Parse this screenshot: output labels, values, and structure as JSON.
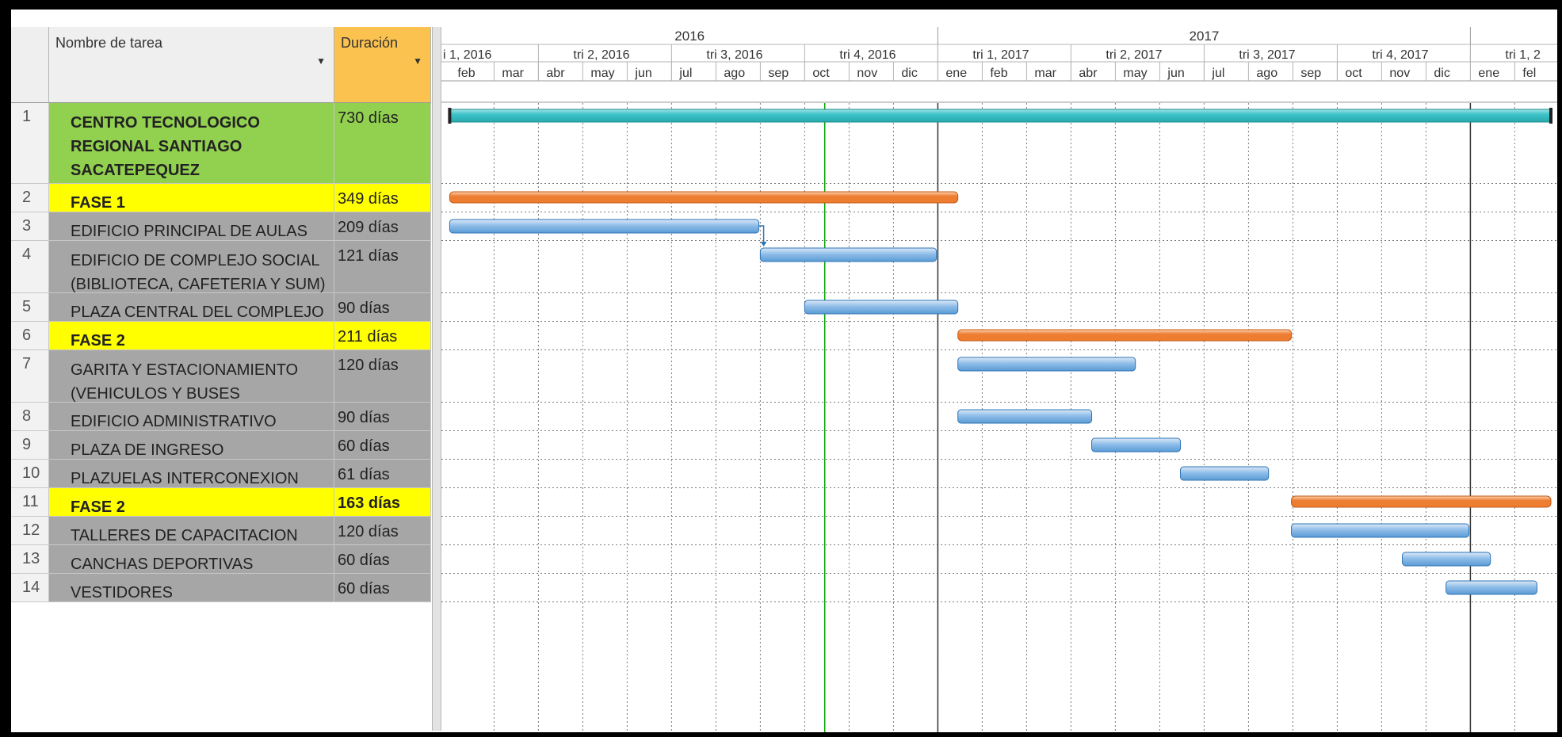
{
  "table": {
    "header_id": "",
    "header_name": "Nombre de tarea",
    "header_duration": "Duración",
    "dropdown_glyph": "▼",
    "rows": [
      {
        "id": "1",
        "name": "CENTRO TECNOLOGICO REGIONAL SANTIAGO SACATEPEQUEZ",
        "name_lines": [
          "CENTRO TECNOLOGICO",
          "REGIONAL SANTIAGO",
          "SACATEPEQUEZ"
        ],
        "duration": "730 días",
        "style": "green"
      },
      {
        "id": "2",
        "name": "FASE 1",
        "name_lines": [
          "FASE 1"
        ],
        "duration": "349 días",
        "style": "yellow"
      },
      {
        "id": "3",
        "name": "EDIFICIO PRINCIPAL DE AULAS",
        "name_lines": [
          "EDIFICIO PRINCIPAL DE AULAS"
        ],
        "duration": "209 días",
        "style": "grey"
      },
      {
        "id": "4",
        "name": "EDIFICIO DE COMPLEJO SOCIAL (BIBLIOTECA, CAFETERIA Y SUM)",
        "name_lines": [
          "EDIFICIO DE COMPLEJO SOCIAL",
          "(BIBLIOTECA, CAFETERIA Y SUM)"
        ],
        "duration": "121 días",
        "style": "grey"
      },
      {
        "id": "5",
        "name": "PLAZA CENTRAL DEL COMPLEJO",
        "name_lines": [
          "PLAZA CENTRAL DEL COMPLEJO"
        ],
        "duration": "90 días",
        "style": "grey"
      },
      {
        "id": "6",
        "name": "FASE 2",
        "name_lines": [
          "FASE 2"
        ],
        "duration": "211 días",
        "style": "yellow"
      },
      {
        "id": "7",
        "name": "GARITA Y ESTACIONAMIENTO (VEHICULOS Y BUSES ESCOLARES)",
        "name_lines": [
          "GARITA Y ESTACIONAMIENTO",
          "(VEHICULOS Y BUSES ESCOLARES)"
        ],
        "duration": "120 días",
        "style": "grey"
      },
      {
        "id": "8",
        "name": "EDIFICIO ADMINISTRATIVO",
        "name_lines": [
          "EDIFICIO ADMINISTRATIVO"
        ],
        "duration": "90 días",
        "style": "grey"
      },
      {
        "id": "9",
        "name": "PLAZA DE INGRESO",
        "name_lines": [
          "PLAZA DE INGRESO"
        ],
        "duration": "60 días",
        "style": "grey"
      },
      {
        "id": "10",
        "name": "PLAZUELAS INTERCONEXION",
        "name_lines": [
          "PLAZUELAS INTERCONEXION"
        ],
        "duration": "61 días",
        "style": "grey"
      },
      {
        "id": "11",
        "name": "FASE 2",
        "name_lines": [
          "FASE 2"
        ],
        "duration": "163 días",
        "style": "yellow"
      },
      {
        "id": "12",
        "name": "TALLERES DE CAPACITACION",
        "name_lines": [
          "TALLERES DE CAPACITACION"
        ],
        "duration": "120 días",
        "style": "grey"
      },
      {
        "id": "13",
        "name": "CANCHAS DEPORTIVAS",
        "name_lines": [
          "CANCHAS DEPORTIVAS"
        ],
        "duration": "60 días",
        "style": "grey"
      },
      {
        "id": "14",
        "name": "VESTIDORES",
        "name_lines": [
          "VESTIDORES"
        ],
        "duration": "60 días",
        "style": "grey"
      }
    ]
  },
  "timescale": {
    "years": [
      "2016",
      "2017"
    ],
    "quarters": [
      "i 1, 2016",
      "tri 2, 2016",
      "tri 3, 2016",
      "tri 4, 2016",
      "tri 1, 2017",
      "tri 2, 2017",
      "tri 3, 2017",
      "tri 4, 2017",
      "tri 1, 2"
    ],
    "months": [
      "feb",
      "mar",
      "abr",
      "may",
      "jun",
      "jul",
      "ago",
      "sep",
      "oct",
      "nov",
      "dic",
      "ene",
      "feb",
      "mar",
      "abr",
      "may",
      "jun",
      "jul",
      "ago",
      "sep",
      "oct",
      "nov",
      "dic",
      "ene",
      "fel"
    ]
  },
  "colors": {
    "summary_project": "#3cc3c8",
    "summary_phase": "#ed7d31",
    "task_bar": "#5b9bd5",
    "today_line": "#00a000",
    "green_row": "#92d050",
    "yellow_row": "#ffff00",
    "grey_row": "#a6a6a6",
    "duration_header": "#fbc24f"
  },
  "chart_data": {
    "type": "gantt",
    "timeline_start": "2016-01-01",
    "timeline_end": "2018-02-28",
    "today_marker": "2016-10-15",
    "tasks": [
      {
        "id": 1,
        "kind": "project",
        "start": "2016-02-01",
        "end": "2018-02-28"
      },
      {
        "id": 2,
        "kind": "summary",
        "start": "2016-02-01",
        "end": "2017-01-15"
      },
      {
        "id": 3,
        "kind": "task",
        "start": "2016-02-01",
        "end": "2016-08-31"
      },
      {
        "id": 4,
        "kind": "task",
        "start": "2016-09-01",
        "end": "2016-12-31"
      },
      {
        "id": 5,
        "kind": "task",
        "start": "2016-10-01",
        "end": "2017-01-15"
      },
      {
        "id": 6,
        "kind": "summary",
        "start": "2017-01-15",
        "end": "2017-08-31"
      },
      {
        "id": 7,
        "kind": "task",
        "start": "2017-01-15",
        "end": "2017-05-15"
      },
      {
        "id": 8,
        "kind": "task",
        "start": "2017-01-15",
        "end": "2017-04-15"
      },
      {
        "id": 9,
        "kind": "task",
        "start": "2017-04-15",
        "end": "2017-06-15"
      },
      {
        "id": 10,
        "kind": "task",
        "start": "2017-06-15",
        "end": "2017-08-15"
      },
      {
        "id": 11,
        "kind": "summary",
        "start": "2017-08-31",
        "end": "2018-02-28"
      },
      {
        "id": 12,
        "kind": "task",
        "start": "2017-08-31",
        "end": "2017-12-31"
      },
      {
        "id": 13,
        "kind": "task",
        "start": "2017-11-15",
        "end": "2018-01-15"
      },
      {
        "id": 14,
        "kind": "task",
        "start": "2017-12-15",
        "end": "2018-02-15"
      }
    ],
    "dependencies": [
      {
        "from": 3,
        "to": 4
      }
    ]
  }
}
